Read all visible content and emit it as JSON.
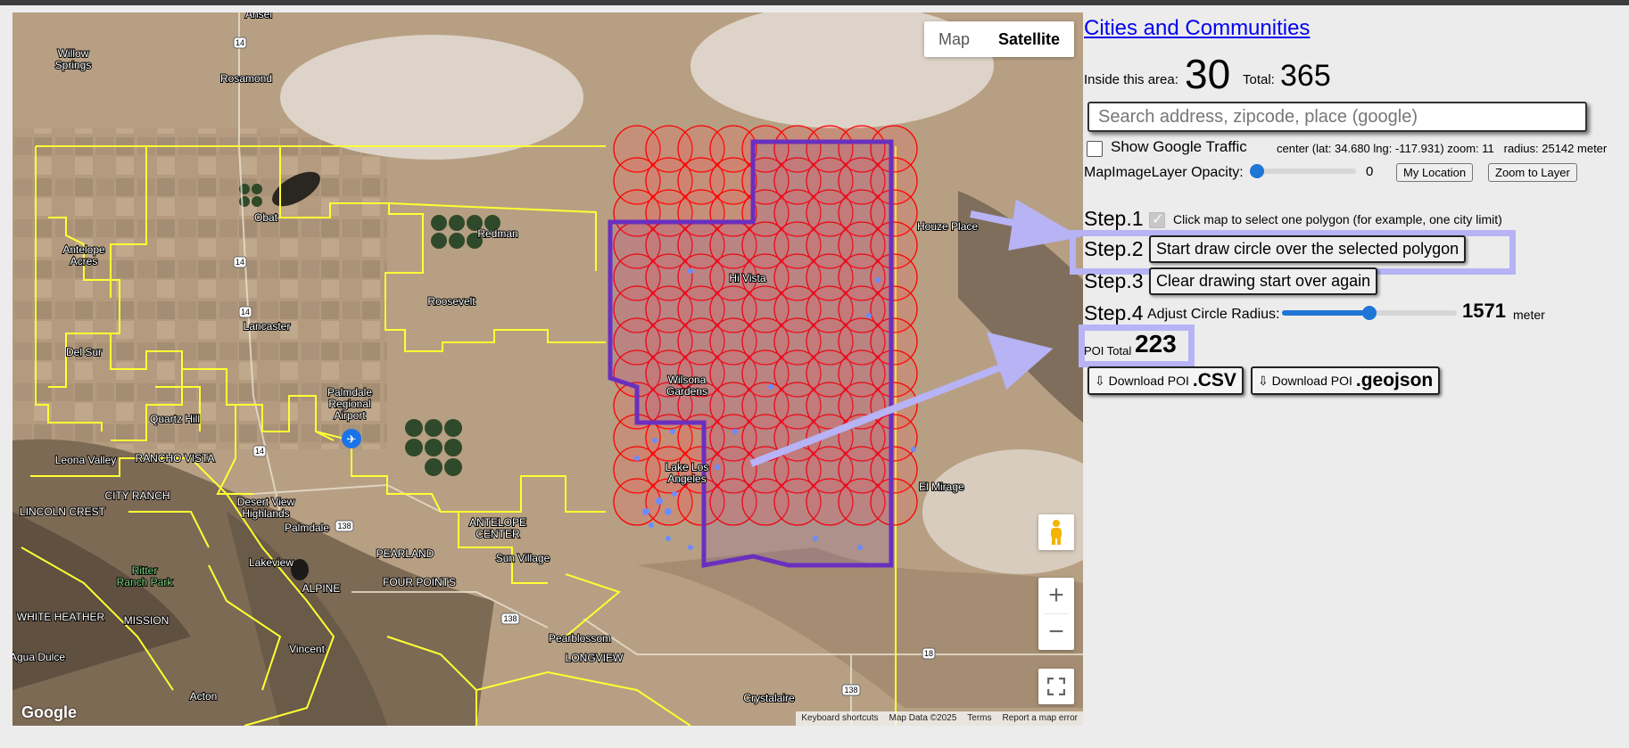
{
  "map": {
    "type_buttons": {
      "map": "Map",
      "satellite": "Satellite"
    },
    "labels": [
      {
        "id": "antelope-acres",
        "text": "Antelope\nAcres"
      },
      {
        "id": "willow-springs",
        "text": "Willow\nSprings"
      },
      {
        "id": "rosamond",
        "text": "Rosamond"
      },
      {
        "id": "redman",
        "text": "Redman"
      },
      {
        "id": "roosevelt",
        "text": "Roosevelt"
      },
      {
        "id": "lancaster",
        "text": "Lancaster"
      },
      {
        "id": "del-sur",
        "text": "Del Sur"
      },
      {
        "id": "quartz-hill",
        "text": "Quartz Hill"
      },
      {
        "id": "palmdale-airport",
        "text": "Palmdale\nRegional\nAirport"
      },
      {
        "id": "leona-valley",
        "text": "Leona Valley"
      },
      {
        "id": "rancho-vista",
        "text": "RANCHO VISTA"
      },
      {
        "id": "city-ranch",
        "text": "CITY RANCH"
      },
      {
        "id": "lincoln-crest",
        "text": "LINCOLN CREST"
      },
      {
        "id": "desert-view",
        "text": "Desert View\nHighlands"
      },
      {
        "id": "palmdale",
        "text": "Palmdale"
      },
      {
        "id": "antelope-center",
        "text": "ANTELOPE\nCENTER"
      },
      {
        "id": "sun-village",
        "text": "Sun Village"
      },
      {
        "id": "pearland",
        "text": "PEARLAND"
      },
      {
        "id": "lake-la",
        "text": "Lake Los\nAngeles"
      },
      {
        "id": "wilsona",
        "text": "Wilsona\nGardens"
      },
      {
        "id": "hi-vista",
        "text": "Hi Vista"
      },
      {
        "id": "houze-place",
        "text": "Houze Place"
      },
      {
        "id": "el-mirage",
        "text": "El Mirage"
      },
      {
        "id": "ritter",
        "text": "Ritter\nRanch Park"
      },
      {
        "id": "lake-los",
        "text": "Lake Los"
      },
      {
        "id": "alpine",
        "text": "ALPINE"
      },
      {
        "id": "four-points",
        "text": "FOUR POINTS"
      },
      {
        "id": "white-heather",
        "text": "WHITE HEATHER"
      },
      {
        "id": "mission",
        "text": "MISSION"
      },
      {
        "id": "vincent",
        "text": "Vincent"
      },
      {
        "id": "agua-dulce",
        "text": "Agua Dulce"
      },
      {
        "id": "acton",
        "text": "Acton"
      },
      {
        "id": "pearblossom",
        "text": "Pearblossom"
      },
      {
        "id": "longview",
        "text": "LONGVIEW"
      },
      {
        "id": "crystalaire",
        "text": "Crystalaire"
      },
      {
        "id": "obat",
        "text": "Obat"
      },
      {
        "id": "anselr",
        "text": "Ansel"
      },
      {
        "id": "lakeview",
        "text": "Lakeview"
      }
    ],
    "shields": [
      "14",
      "14",
      "14",
      "14",
      "138",
      "138",
      "138",
      "18"
    ],
    "google_logo": "Google",
    "attribution": [
      "Keyboard shortcuts",
      "Map Data ©2025",
      "Terms",
      "Report a map error"
    ]
  },
  "panel": {
    "title": "Cities and Communities",
    "inside_label": "Inside this area:",
    "inside_count": "30",
    "total_label": "Total:",
    "total_count": "365",
    "search_placeholder": "Search address, zipcode, place (google)",
    "traffic_label": "Show Google Traffic",
    "center_info": "center (lat: 34.680 lng: -117.931) zoom: 11   radius: 25142 meter",
    "opacity_label": "MapImageLayer Opacity:",
    "opacity_value": "0",
    "opacity_level": 0,
    "my_location": "My Location",
    "zoom_layer": "Zoom to Layer",
    "step1_label": "Step.1",
    "step1_text": "Click map to select one polygon (for example, one city limit)",
    "step2_label": "Step.2",
    "step2_button": "Start draw circle over the selected polygon",
    "step3_label": "Step.3",
    "step3_button": "Clear drawing start over again",
    "step4_label": "Step.4",
    "step4_text": "Adjust Circle Radius:",
    "radius_value": "1571",
    "radius_unit": "meter",
    "radius_level": 0.5,
    "poi_label": "POI Total",
    "poi_total": "223",
    "download_csv_prefix": "⇩ Download POI",
    "download_csv_ext": ".CSV",
    "download_geojson_prefix": "⇩ Download POI",
    "download_geojson_ext": ".geojson"
  },
  "colors": {
    "link": "#0000ee",
    "highlight": "#b7b3f5",
    "slider": "#1e76d6",
    "boundary": "#ffff33",
    "circle": "#ff0000",
    "polygon": "#6a2fbf"
  }
}
